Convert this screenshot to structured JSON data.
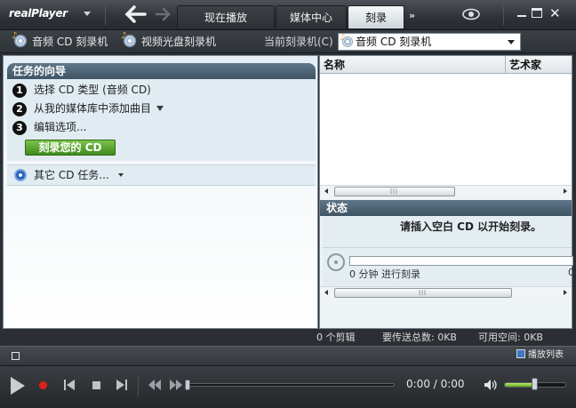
{
  "app": {
    "logo_text": "realPlayer"
  },
  "tabs": [
    {
      "label": "现在播放",
      "active": false
    },
    {
      "label": "媒体中心",
      "active": false
    },
    {
      "label": "刻录",
      "active": true
    }
  ],
  "tabs_more": "»",
  "toolbar": {
    "audio_cd_burner": "音频 CD 刻录机",
    "video_disc_burner": "视频光盘刻录机",
    "current_burner_label": "当前刻录机(C)",
    "current_burner_value": "音频 CD 刻录机"
  },
  "wizard": {
    "title": "任务的向导",
    "steps": [
      {
        "num": "1",
        "label": "选择 CD 类型 (音频 CD)"
      },
      {
        "num": "2",
        "label": "从我的媒体库中添加曲目"
      },
      {
        "num": "3",
        "label": "编辑选项..."
      }
    ],
    "burn_button": "刻录您的 CD",
    "other_tasks": "其它 CD 任务..."
  },
  "track_list": {
    "columns": [
      "名称",
      "艺术家"
    ],
    "rows": []
  },
  "status": {
    "title": "状态",
    "message": "请插入空白 CD 以开始刻录。",
    "progress_text": "0 分钟 进行刻录",
    "progress_right": "0",
    "progress_fraction": 0
  },
  "info": {
    "clips": "0 个剪辑",
    "total_to_send": "要传送总数: 0KB",
    "free_space": "可用空间: 0KB"
  },
  "lower": {
    "playlist_label": "播放列表"
  },
  "player": {
    "time": "0:00 / 0:00",
    "seek_fraction": 0,
    "volume_fraction": 0.5
  },
  "colors": {
    "burn_button": "#4f9a27",
    "record": "#e0201c",
    "panel_header": "#4a6274"
  }
}
